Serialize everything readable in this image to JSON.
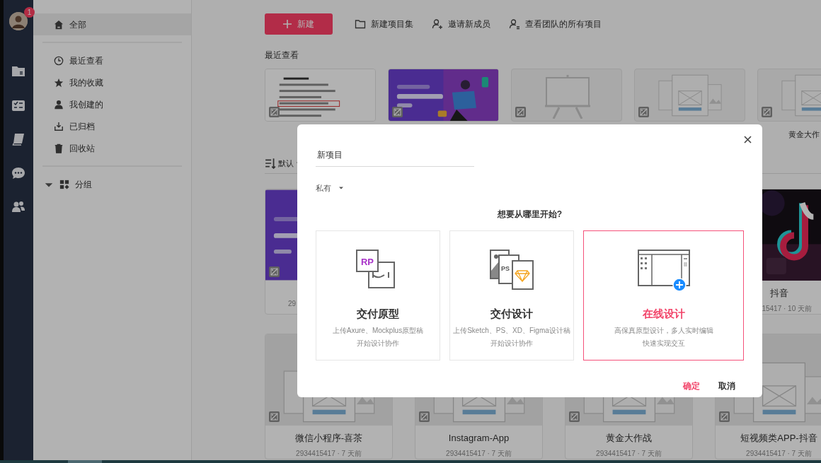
{
  "nav_rail": {
    "badge": "1"
  },
  "sidebar": {
    "items": [
      {
        "label": "全部",
        "selected": true
      },
      {
        "label": "最近查看",
        "selected": false
      },
      {
        "label": "我的收藏",
        "selected": false
      },
      {
        "label": "我创建的",
        "selected": false
      },
      {
        "label": "已归档",
        "selected": false
      },
      {
        "label": "回收站",
        "selected": false
      }
    ],
    "group": {
      "label": "分组"
    }
  },
  "toolbar": {
    "new_button": "新建",
    "actions": [
      {
        "label": "新建项目集"
      },
      {
        "label": "邀请新成员"
      },
      {
        "label": "查看团队的所有项目"
      }
    ]
  },
  "recent": {
    "title": "最近查看",
    "items": [
      {
        "kind": "document"
      },
      {
        "kind": "banner"
      },
      {
        "kind": "board"
      },
      {
        "kind": "prototype"
      },
      {
        "kind": "prototype",
        "title": "黄金大作"
      }
    ]
  },
  "sort": {
    "label": "默认"
  },
  "projects": [
    {
      "kind": "banner",
      "meta": "29"
    },
    {
      "kind": "dark",
      "title": "抖音",
      "meta": "15417 · 10 天前"
    },
    {
      "kind": "prototype",
      "title": "微信小程序-喜茶",
      "meta": "2934415417 · 7 天前"
    },
    {
      "kind": "prototype",
      "title": "Instagram-App",
      "meta": "2934415417 · 7 天前"
    },
    {
      "kind": "prototype",
      "title": "黄金大作战",
      "meta": "2934415417 · 7 天前"
    },
    {
      "kind": "prototype",
      "title": "短视频类APP-抖音",
      "meta": "2934415417 · 7 天前"
    }
  ],
  "dialog": {
    "name_value": "新项目",
    "visibility": "私有",
    "question": "想要从哪里开始?",
    "options": [
      {
        "kind": "prototype",
        "badge": "RP",
        "title": "交付原型",
        "lines": [
          "上传Axure、Mockplus原型稿",
          "开始设计协作"
        ],
        "selected": false
      },
      {
        "kind": "design",
        "badge": "PS",
        "title": "交付设计",
        "lines": [
          "上传Sketch、PS、XD、Figma设计稿",
          "开始设计协作"
        ],
        "selected": false
      },
      {
        "kind": "online",
        "title": "在线设计",
        "lines": [
          "高保真原型设计，多人实时编辑",
          "快速实现交互"
        ],
        "selected": true
      }
    ],
    "confirm": "确定",
    "cancel": "取消"
  }
}
